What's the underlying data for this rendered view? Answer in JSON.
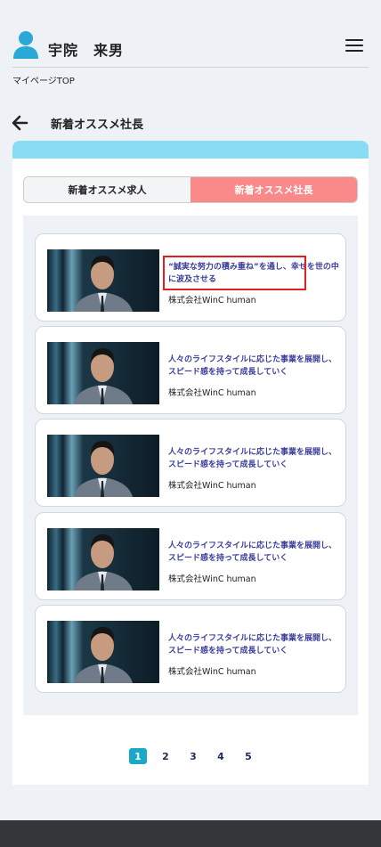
{
  "header": {
    "user_name": "宇院　来男",
    "breadcrumb": "マイページTOP"
  },
  "page": {
    "title": "新着オススメ社長"
  },
  "tabs": [
    {
      "label": "新着オススメ求人",
      "active": false
    },
    {
      "label": "新着オススメ社長",
      "active": true
    }
  ],
  "cards": [
    {
      "title": "“誠実な努力の積み重ね”を通し、幸せを世の中に波及させる",
      "company": "株式会社WinC human"
    },
    {
      "title": "人々のライフスタイルに応じた事業を展開し、スピード感を持って成長していく",
      "company": "株式会社WinC human"
    },
    {
      "title": "人々のライフスタイルに応じた事業を展開し、スピード感を持って成長していく",
      "company": "株式会社WinC human"
    },
    {
      "title": "人々のライフスタイルに応じた事業を展開し、スピード感を持って成長していく",
      "company": "株式会社WinC human"
    },
    {
      "title": "人々のライフスタイルに応じた事業を展開し、スピード感を持って成長していく",
      "company": "株式会社WinC human"
    }
  ],
  "pagination": {
    "pages": [
      "1",
      "2",
      "3",
      "4",
      "5"
    ],
    "current": "1"
  },
  "colors": {
    "panel_top": "#8adcf2",
    "tab_active": "#fa8a8a",
    "card_title": "#3b3e9a",
    "page_current": "#1aa8c8",
    "highlight": "#e02020"
  }
}
